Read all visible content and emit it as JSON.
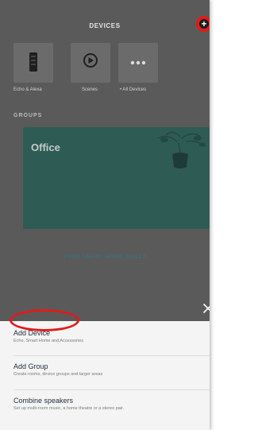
{
  "header": {
    "title": "DEVICES",
    "add_icon": "plus-icon"
  },
  "tiles": [
    {
      "label": "Echo & Alexa",
      "icon": "echo-device-icon"
    },
    {
      "label": "Scenes",
      "icon": "play-icon"
    },
    {
      "label": "• All Devices",
      "icon": "more-dots-icon"
    }
  ],
  "groups": {
    "heading": "GROUPS",
    "items": [
      {
        "label": "Office",
        "icon": "plant-icon"
      }
    ]
  },
  "skills": {
    "label": "YOUR SMART HOME SKILLS"
  },
  "sheet": {
    "close_icon": "close-icon",
    "options": [
      {
        "title": "Add Device",
        "subtitle": "Echo, Smart Home and Accessories"
      },
      {
        "title": "Add Group",
        "subtitle": "Create rooms, device groups and larger areas"
      },
      {
        "title": "Combine speakers",
        "subtitle": "Set up multi-room music, a home theatre or a stereo pair."
      }
    ]
  },
  "colors": {
    "overlay": "#5a5a5a",
    "card": "#2f5b55",
    "highlight": "#e21b1b",
    "sheet": "#f4f4f4",
    "link": "#3f6f78"
  }
}
